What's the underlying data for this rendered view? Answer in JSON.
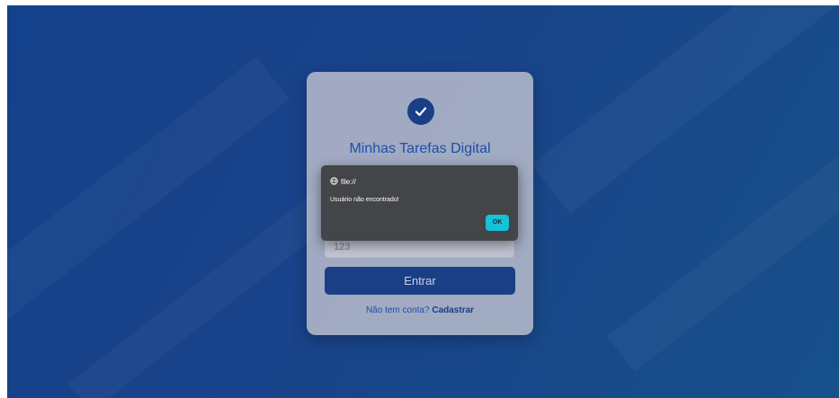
{
  "app": {
    "title": "Minhas Tarefas Digital",
    "logo_icon": "check-circle-icon"
  },
  "form": {
    "username_value": "",
    "password_value": "123",
    "submit_label": "Entrar",
    "signup_prompt": "Não tem conta?",
    "signup_link": "Cadastrar"
  },
  "dialog": {
    "origin_icon": "globe-icon",
    "origin": "file://",
    "message": "Usuário não encontrado!",
    "ok_label": "OK"
  },
  "colors": {
    "background": "#17458a",
    "card": "#c8c8d2",
    "primary": "#1a3f86",
    "title": "#1e4fa8",
    "dialog_bg": "#434548",
    "ok_button": "#17c1d6"
  }
}
